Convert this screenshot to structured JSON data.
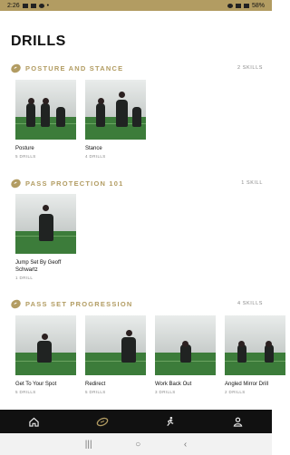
{
  "status": {
    "time": "2:26",
    "battery": "58%"
  },
  "page_title": "DRILLS",
  "sections": [
    {
      "title": "POSTURE AND STANCE",
      "count": "2 SKILLS",
      "cards": [
        {
          "title": "Posture",
          "sub": "5 DRILLS"
        },
        {
          "title": "Stance",
          "sub": "4 DRILLS"
        }
      ]
    },
    {
      "title": "PASS PROTECTION 101",
      "count": "1 SKILL",
      "cards": [
        {
          "title": "Jump Set By Geoff Schwartz",
          "sub": "1 DRILL"
        }
      ]
    },
    {
      "title": "PASS SET PROGRESSION",
      "count": "4 SKILLS",
      "cards": [
        {
          "title": "Get To Your Spot",
          "sub": "5 DRILLS"
        },
        {
          "title": "Redirect",
          "sub": "5 DRILLS"
        },
        {
          "title": "Work Back Out",
          "sub": "3 DRILLS"
        },
        {
          "title": "Angled Mirror Drill",
          "sub": "2 DRILLS"
        }
      ]
    }
  ],
  "nav": {
    "items": [
      "home-icon",
      "football-icon",
      "running-icon",
      "profile-icon"
    ]
  },
  "colors": {
    "accent": "#b29c62",
    "nav_bg": "#111111",
    "turf": "#3c7c3a"
  }
}
